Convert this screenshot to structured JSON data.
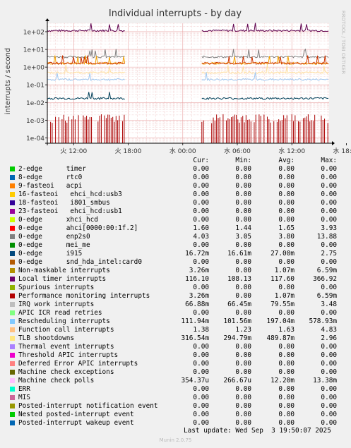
{
  "chart_data": {
    "type": "line",
    "title": "Individual interrupts - by day",
    "ylabel": "interrupts / second",
    "yscale": "log",
    "ylim": [
      5e-05,
      300
    ],
    "y_ticks": [
      "1e-04",
      "1e-03",
      "1e-02",
      "1e-01",
      "1e+00",
      "1e+01",
      "1e+02"
    ],
    "x_ticks": [
      "火 12:00",
      "火 18:00",
      "水 00:00",
      "水 06:00",
      "水 12:00",
      "水 18:00"
    ],
    "xlim_hours": [
      9.1,
      40.1
    ],
    "gap_hours": [
      17.7,
      26.1
    ],
    "grid": true,
    "side_label": "RRDTOOL / TOBI OETIKER",
    "series_levels": [
      {
        "name": "Local timer interrupts",
        "color": "#5e004e",
        "level": 116.1
      },
      {
        "name": "APIC ICR read retries",
        "color": "#808080",
        "level": 3.8
      },
      {
        "name": "Function call interrupts",
        "color": "#f2a000",
        "level": 1.63
      },
      {
        "name": "ahci[0000:00:1f.2]",
        "color": "#cc3300",
        "level": 1.65
      },
      {
        "name": "TLB shootdowns",
        "color": "#ffe0a0",
        "level": 0.49
      },
      {
        "name": "Rescheduling interrupts",
        "color": "#a0c8f0",
        "level": 0.2
      },
      {
        "name": "i915",
        "color": "#00405a",
        "level": 0.017
      },
      {
        "name": "Performance monitoring interrupts",
        "color": "#aa0000",
        "level": 0.0011
      }
    ]
  },
  "legend": {
    "headers": [
      "Cur:",
      "Min:",
      "Avg:",
      "Max:"
    ],
    "rows": [
      {
        "color": "#00cc00",
        "name": "2-edge      timer",
        "cur": "0.00",
        "min": "0.00",
        "avg": "0.00",
        "max": "0.00"
      },
      {
        "color": "#0066b3",
        "name": "8-edge      rtc0",
        "cur": "0.00",
        "min": "0.00",
        "avg": "0.00",
        "max": "0.00"
      },
      {
        "color": "#ff8000",
        "name": "9-fasteoi   acpi",
        "cur": "0.00",
        "min": "0.00",
        "avg": "0.00",
        "max": "0.00"
      },
      {
        "color": "#ffcc00",
        "name": "16-fasteoi   ehci_hcd:usb3",
        "cur": "0.00",
        "min": "0.00",
        "avg": "0.00",
        "max": "0.00"
      },
      {
        "color": "#330099",
        "name": "18-fasteoi   i801_smbus",
        "cur": "0.00",
        "min": "0.00",
        "avg": "0.00",
        "max": "0.00"
      },
      {
        "color": "#990099",
        "name": "23-fasteoi   ehci_hcd:usb1",
        "cur": "0.00",
        "min": "0.00",
        "avg": "0.00",
        "max": "0.00"
      },
      {
        "color": "#ccff00",
        "name": "0-edge      xhci_hcd",
        "cur": "0.00",
        "min": "0.00",
        "avg": "0.00",
        "max": "0.00"
      },
      {
        "color": "#ff0000",
        "name": "0-edge      ahci[0000:00:1f.2]",
        "cur": "1.60",
        "min": "1.44",
        "avg": "1.65",
        "max": "3.93"
      },
      {
        "color": "#808080",
        "name": "0-edge      enp2s0",
        "cur": "4.03",
        "min": "3.05",
        "avg": "3.80",
        "max": "13.88"
      },
      {
        "color": "#008f00",
        "name": "0-edge      mei_me",
        "cur": "0.00",
        "min": "0.00",
        "avg": "0.00",
        "max": "0.00"
      },
      {
        "color": "#00487d",
        "name": "0-edge      i915",
        "cur": "16.72m",
        "min": "16.61m",
        "avg": "27.00m",
        "max": "2.75"
      },
      {
        "color": "#b35a00",
        "name": "0-edge      snd_hda_intel:card0",
        "cur": "0.00",
        "min": "0.00",
        "avg": "0.00",
        "max": "0.00"
      },
      {
        "color": "#b38f00",
        "name": "Non-maskable interrupts",
        "cur": "3.26m",
        "min": "0.00",
        "avg": "1.07m",
        "max": "6.59m"
      },
      {
        "color": "#6b006b",
        "name": "Local timer interrupts",
        "cur": "116.10",
        "min": "108.13",
        "avg": "117.60",
        "max": "366.92"
      },
      {
        "color": "#8fb300",
        "name": "Spurious interrupts",
        "cur": "0.00",
        "min": "0.00",
        "avg": "0.00",
        "max": "0.00"
      },
      {
        "color": "#b30000",
        "name": "Performance monitoring interrupts",
        "cur": "3.26m",
        "min": "0.00",
        "avg": "1.07m",
        "max": "6.59m"
      },
      {
        "color": "#bebebe",
        "name": "IRQ work interrupts",
        "cur": "66.88m",
        "min": "66.45m",
        "avg": "79.55m",
        "max": "3.48"
      },
      {
        "color": "#80ff80",
        "name": "APIC ICR read retries",
        "cur": "0.00",
        "min": "0.00",
        "avg": "0.00",
        "max": "0.00"
      },
      {
        "color": "#80c9ff",
        "name": "Rescheduling interrupts",
        "cur": "111.94m",
        "min": "101.56m",
        "avg": "197.04m",
        "max": "578.93m"
      },
      {
        "color": "#ffc080",
        "name": "Function call interrupts",
        "cur": "1.38",
        "min": "1.23",
        "avg": "1.63",
        "max": "4.83"
      },
      {
        "color": "#ffe680",
        "name": "TLB shootdowns",
        "cur": "316.54m",
        "min": "294.79m",
        "avg": "489.87m",
        "max": "2.96"
      },
      {
        "color": "#aa80ff",
        "name": "Thermal event interrupts",
        "cur": "0.00",
        "min": "0.00",
        "avg": "0.00",
        "max": "0.00"
      },
      {
        "color": "#ee00cc",
        "name": "Threshold APIC interrupts",
        "cur": "0.00",
        "min": "0.00",
        "avg": "0.00",
        "max": "0.00"
      },
      {
        "color": "#ff8080",
        "name": "Deferred Error APIC interrupts",
        "cur": "0.00",
        "min": "0.00",
        "avg": "0.00",
        "max": "0.00"
      },
      {
        "color": "#666600",
        "name": "Machine check exceptions",
        "cur": "0.00",
        "min": "0.00",
        "avg": "0.00",
        "max": "0.00"
      },
      {
        "color": "#ffbfff",
        "name": "Machine check polls",
        "cur": "354.37u",
        "min": "266.67u",
        "avg": "12.20m",
        "max": "13.38m"
      },
      {
        "color": "#00ffcc",
        "name": "ERR",
        "cur": "0.00",
        "min": "0.00",
        "avg": "0.00",
        "max": "0.00"
      },
      {
        "color": "#cc6699",
        "name": "MIS",
        "cur": "0.00",
        "min": "0.00",
        "avg": "0.00",
        "max": "0.00"
      },
      {
        "color": "#999900",
        "name": "Posted-interrupt notification event",
        "cur": "0.00",
        "min": "0.00",
        "avg": "0.00",
        "max": "0.00"
      },
      {
        "color": "#00cc00",
        "name": "Nested posted-interrupt event",
        "cur": "0.00",
        "min": "0.00",
        "avg": "0.00",
        "max": "0.00"
      },
      {
        "color": "#0066b3",
        "name": "Posted-interrupt wakeup event",
        "cur": "0.00",
        "min": "0.00",
        "avg": "0.00",
        "max": "0.00"
      }
    ]
  },
  "footer": {
    "last_update": "Last update: Wed Sep  3 19:50:07 2025",
    "version": "Munin 2.0.75"
  }
}
